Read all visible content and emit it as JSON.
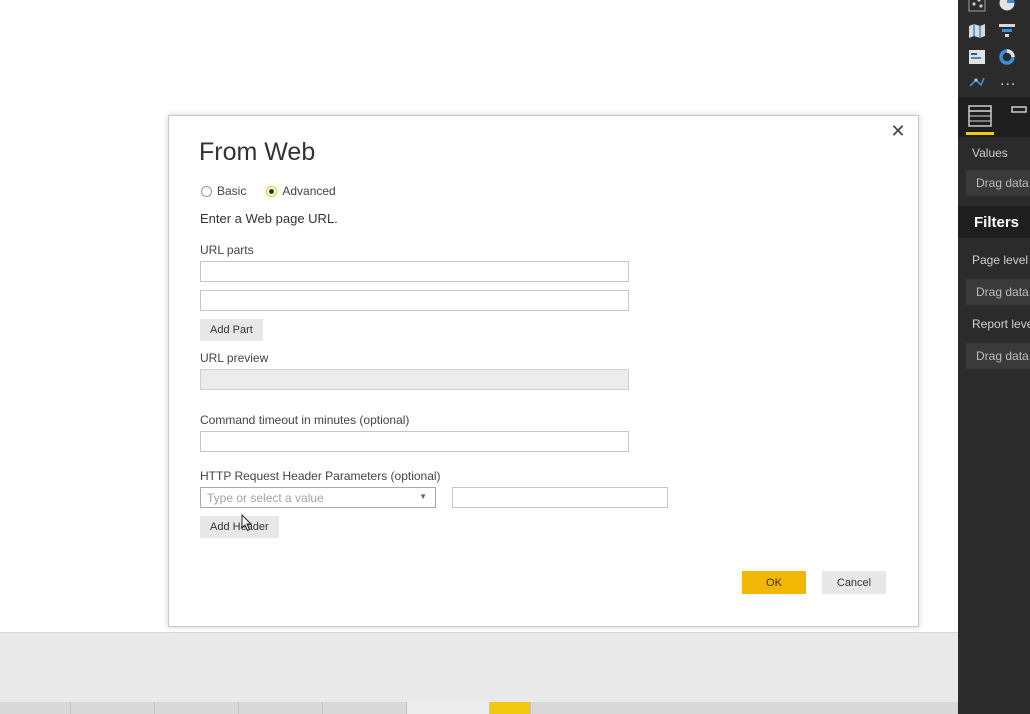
{
  "dialog": {
    "title": "From Web",
    "close_label": "✕",
    "modes": [
      {
        "label": "Basic",
        "selected": false
      },
      {
        "label": "Advanced",
        "selected": true
      }
    ],
    "instruction": "Enter a Web page URL.",
    "url_parts_label": "URL parts",
    "url_parts": [
      "",
      ""
    ],
    "add_part_label": "Add Part",
    "url_preview_label": "URL preview",
    "url_preview_value": "",
    "timeout_label": "Command timeout in minutes (optional)",
    "timeout_value": "",
    "headers_label": "HTTP Request Header Parameters (optional)",
    "header_name_placeholder": "Type or select a value",
    "header_value": "",
    "add_header_label": "Add Header",
    "ok_label": "OK",
    "cancel_label": "Cancel"
  },
  "right_pane": {
    "values_label": "Values",
    "values_drop": "Drag data fields here",
    "filters_title": "Filters",
    "page_level_label": "Page level filters",
    "page_level_drop": "Drag data fields here",
    "report_level_label": "Report level filters",
    "report_level_drop": "Drag data fields here",
    "more_label": "..."
  },
  "colors": {
    "accent": "#f2c811",
    "ok_button": "#f2b705",
    "pane_bg": "#2b2b2b"
  }
}
